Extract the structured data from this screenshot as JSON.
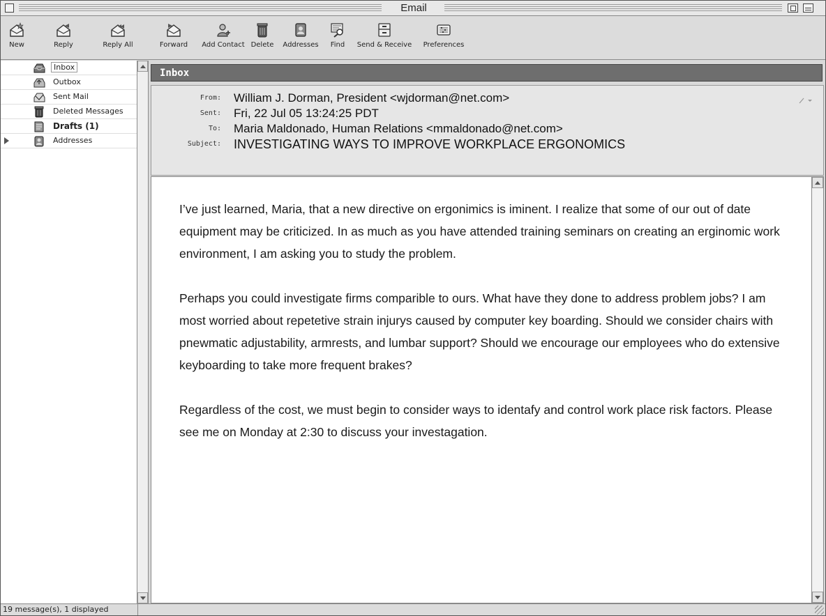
{
  "window": {
    "title": "Email"
  },
  "toolbar": {
    "buttons": [
      {
        "label": "New",
        "icon": "new-message-icon"
      },
      {
        "label": "Reply",
        "icon": "reply-icon"
      },
      {
        "label": "Reply All",
        "icon": "reply-all-icon"
      },
      {
        "label": "Forward",
        "icon": "forward-icon"
      },
      {
        "label": "Add Contact",
        "icon": "add-contact-icon"
      },
      {
        "label": "Delete",
        "icon": "trash-icon"
      },
      {
        "label": "Addresses",
        "icon": "addresses-icon"
      },
      {
        "label": "Find",
        "icon": "find-icon"
      },
      {
        "label": "Send & Receive",
        "icon": "send-receive-icon"
      },
      {
        "label": "Preferences",
        "icon": "preferences-icon"
      }
    ]
  },
  "sidebar": {
    "items": [
      {
        "label": "Inbox",
        "icon": "inbox-icon",
        "selected": true
      },
      {
        "label": "Outbox",
        "icon": "outbox-icon"
      },
      {
        "label": "Sent Mail",
        "icon": "sent-mail-icon"
      },
      {
        "label": "Deleted Messages",
        "icon": "trash-icon"
      },
      {
        "label": "Drafts (1)",
        "icon": "drafts-icon",
        "bold": true
      },
      {
        "label": "Addresses",
        "icon": "addresses-icon",
        "expandable": true
      }
    ]
  },
  "main": {
    "folder_title": "Inbox",
    "header": {
      "from_label": "From:",
      "from": "William J. Dorman, President <wjdorman@net.com>",
      "sent_label": "Sent:",
      "sent": "Fri, 22 Jul 05 13:24:25 PDT",
      "to_label": "To:",
      "to": "Maria Maldonado, Human Relations <mmaldonado@net.com>",
      "subject_label": "Subject:",
      "subject": "INVESTIGATING WAYS TO IMPROVE WORKPLACE ERGONOMICS"
    },
    "body": {
      "paragraphs": [
        "I’ve just learned, Maria, that a new directive on ergonimics is iminent. I realize that some of our out of date equipment may be criticized. In as much as you have attended training seminars on creating an erginomic work environment, I am asking you to study the problem.",
        "Perhaps you could investigate firms comparible to ours. What have they done to address problem jobs? I am most worried about repetetive strain injurys caused by computer key boarding. Should we consider chairs with pnewmatic adjustability, armrests, and lumbar support? Should we encourage our employees who do extensive keyboarding to take more frequent brakes?",
        "Regardless of the cost, we must begin to consider ways to identafy and control work place risk factors. Please see me on Monday at 2:30 to discuss your investagation."
      ]
    }
  },
  "status": {
    "text": "19 message(s), 1 displayed"
  },
  "colors": {
    "folder_bar": "#6e6e6e",
    "chrome": "#d9d9d9"
  }
}
